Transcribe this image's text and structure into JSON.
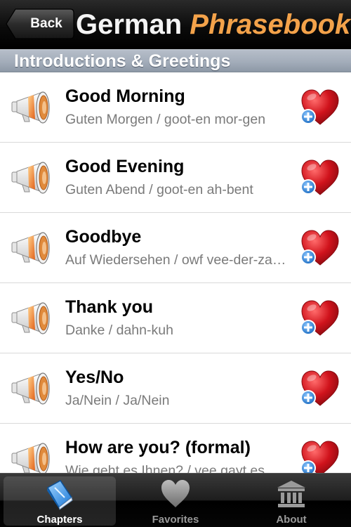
{
  "navbar": {
    "back_label": "Back",
    "title_part1": "German",
    "title_part2": "Phrasebook"
  },
  "section": {
    "title": "Introductions & Greetings"
  },
  "rows": [
    {
      "phrase": "Good Morning",
      "translation": "Guten Morgen / goot-en mor-gen"
    },
    {
      "phrase": "Good Evening",
      "translation": "Guten Abend / goot-en ah-bent"
    },
    {
      "phrase": "Goodbye",
      "translation": "Auf Wiedersehen / owf vee-der-zay-en"
    },
    {
      "phrase": "Thank you",
      "translation": "Danke / dahn-kuh"
    },
    {
      "phrase": "Yes/No",
      "translation": "Ja/Nein / Ja/Nein"
    },
    {
      "phrase": "How are you? (formal)",
      "translation": "Wie geht es Ihnen? / vee gayt es ee-nen"
    }
  ],
  "icons": {
    "row_audio": "megaphone-icon",
    "row_favorite": "heart-plus-icon",
    "tab_chapters": "book-icon",
    "tab_favorites": "heart-icon",
    "tab_about": "building-icon"
  },
  "tabs": [
    {
      "label": "Chapters",
      "active": true
    },
    {
      "label": "Favorites",
      "active": false
    },
    {
      "label": "About",
      "active": false
    }
  ],
  "colors": {
    "title_accent": "#f3a24a",
    "heart_red": "#d0131c",
    "plus_blue": "#2f86d8",
    "section_bg": "#a3adba"
  }
}
